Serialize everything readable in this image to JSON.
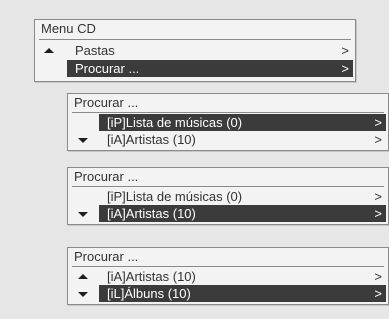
{
  "main_menu": {
    "title": "Menu CD",
    "items": [
      {
        "label": "Pastas",
        "chevron": ">"
      },
      {
        "label": "Procurar ...",
        "chevron": ">"
      }
    ]
  },
  "screen1": {
    "title": "Procurar ...",
    "items": [
      {
        "label": "[iP]Lista de músicas (0)",
        "chevron": ">"
      },
      {
        "label": "[iA]Artistas (10)",
        "chevron": ">"
      }
    ]
  },
  "screen2": {
    "title": "Procurar ...",
    "items": [
      {
        "label": "[iP]Lista de músicas (0)",
        "chevron": ">"
      },
      {
        "label": "[iA]Artistas (10)",
        "chevron": ">"
      }
    ]
  },
  "screen3": {
    "title": "Procurar ...",
    "items": [
      {
        "label": "[iA]Artistas (10)",
        "chevron": ">"
      },
      {
        "label": "[iL]Álbuns (10)",
        "chevron": ">"
      }
    ]
  }
}
